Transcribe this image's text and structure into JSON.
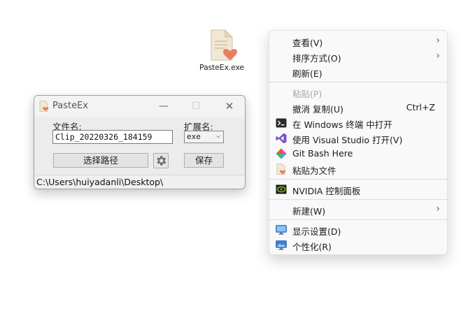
{
  "desktop_icon": {
    "label": "PasteEx.exe"
  },
  "window": {
    "title": "PasteEx",
    "min_glyph": "—",
    "max_glyph": "☐",
    "close_glyph": "✕",
    "filename_label": "文件名:",
    "filename_value": "Clip_20220326_184159",
    "ext_label": "扩展名:",
    "ext_value": "exe",
    "path_button": "选择路径",
    "save_button": "保存",
    "status_path": "C:\\Users\\huiyadanli\\Desktop\\"
  },
  "context_menu": {
    "view": "查看(V)",
    "sort": "排序方式(O)",
    "refresh": "刷新(E)",
    "paste": "粘贴(P)",
    "undo": "撤消 复制(U)",
    "undo_shortcut": "Ctrl+Z",
    "terminal": "在 Windows 终端 中打开",
    "vs": "使用 Visual Studio 打开(V)",
    "gitbash": "Git Bash Here",
    "paste_file": "粘贴为文件",
    "nvidia": "NVIDIA 控制面板",
    "new": "新建(W)",
    "display": "显示设置(D)",
    "personalize": "个性化(R)"
  },
  "colors": {
    "accent_heart": "#e97f62",
    "file_paper": "#f1e7d2",
    "vs_purple": "#7b4fc9",
    "nvidia_green": "#76b900"
  }
}
